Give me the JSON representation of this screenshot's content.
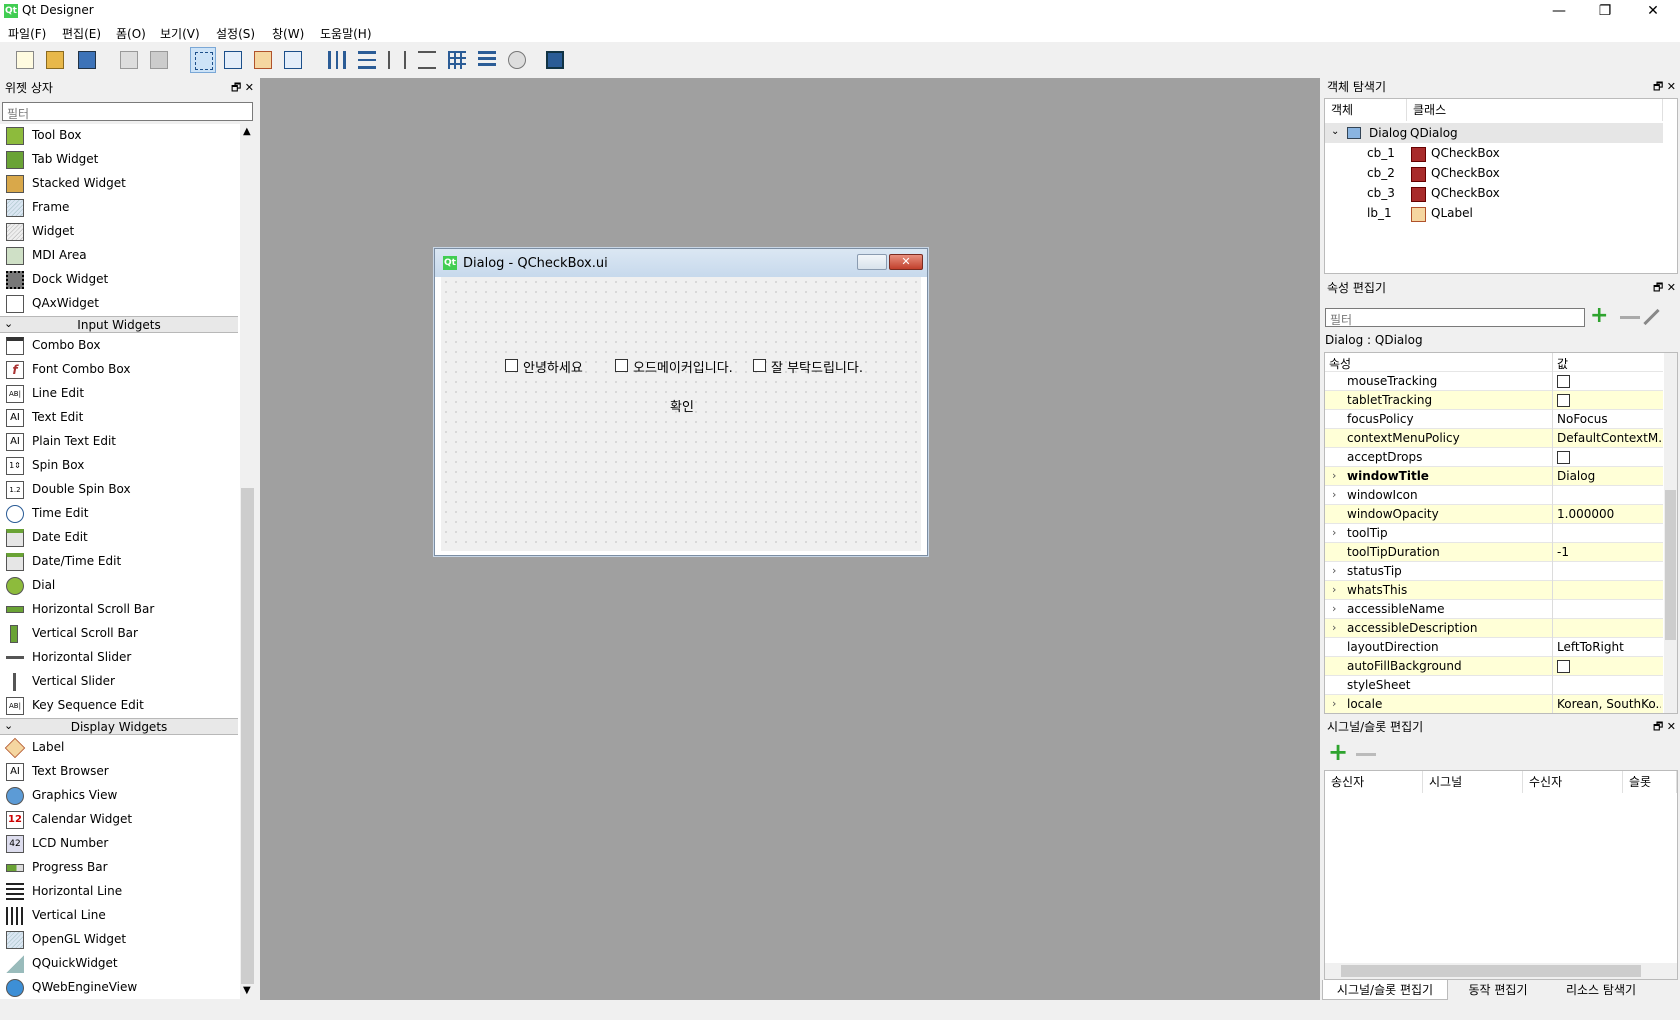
{
  "app": {
    "title": "Qt Designer",
    "logo": "Qt"
  },
  "window_controls": {
    "minimize": "—",
    "maximize": "❐",
    "close": "✕"
  },
  "menu": [
    "파일(F)",
    "편집(E)",
    "폼(O)",
    "보기(V)",
    "설정(S)",
    "창(W)",
    "도움말(H)"
  ],
  "toolbar": {
    "icons": [
      "new-file-icon",
      "open-folder-icon",
      "save-icon",
      "send-to-back-icon",
      "bring-to-front-icon",
      "edit-widgets-icon",
      "edit-signals-slots-icon",
      "edit-buddies-icon",
      "edit-tab-order-icon",
      "layout-horizontal-icon",
      "layout-vertical-icon",
      "layout-h-splitter-icon",
      "layout-v-splitter-icon",
      "layout-grid-icon",
      "layout-form-icon",
      "break-layout-icon",
      "adjust-size-icon"
    ]
  },
  "widget_box": {
    "title": "위젯 상자",
    "filter_placeholder": "필터",
    "items_top": [
      "Tool Box",
      "Tab Widget",
      "Stacked Widget",
      "Frame",
      "Widget",
      "MDI Area",
      "Dock Widget",
      "QAxWidget"
    ],
    "category_input": "Input Widgets",
    "items_input": [
      "Combo Box",
      "Font Combo Box",
      "Line Edit",
      "Text Edit",
      "Plain Text Edit",
      "Spin Box",
      "Double Spin Box",
      "Time Edit",
      "Date Edit",
      "Date/Time Edit",
      "Dial",
      "Horizontal Scroll Bar",
      "Vertical Scroll Bar",
      "Horizontal Slider",
      "Vertical Slider",
      "Key Sequence Edit"
    ],
    "category_display": "Display Widgets",
    "items_display": [
      "Label",
      "Text Browser",
      "Graphics View",
      "Calendar Widget",
      "LCD Number",
      "Progress Bar",
      "Horizontal Line",
      "Vertical Line",
      "OpenGL Widget",
      "QQuickWidget",
      "QWebEngineView"
    ]
  },
  "form": {
    "title": "Dialog - QCheckBox.ui",
    "checkboxes": [
      "안녕하세요",
      "오드메이커입니다.",
      "잘 부탁드립니다."
    ],
    "label": "확인"
  },
  "object_inspector": {
    "title": "객체 탐색기",
    "col_object": "객체",
    "col_class": "클래스",
    "rows": [
      {
        "name": "Dialog",
        "class": "QDialog"
      },
      {
        "name": "cb_1",
        "class": "QCheckBox"
      },
      {
        "name": "cb_2",
        "class": "QCheckBox"
      },
      {
        "name": "cb_3",
        "class": "QCheckBox"
      },
      {
        "name": "lb_1",
        "class": "QLabel"
      }
    ]
  },
  "property_editor": {
    "title": "속성 편집기",
    "filter_placeholder": "필터",
    "object_label": "Dialog : QDialog",
    "col_property": "속성",
    "col_value": "값",
    "rows": [
      {
        "name": "mouseTracking",
        "value": "",
        "check": true
      },
      {
        "name": "tabletTracking",
        "value": "",
        "check": true
      },
      {
        "name": "focusPolicy",
        "value": "NoFocus"
      },
      {
        "name": "contextMenuPolicy",
        "value": "DefaultContextM..."
      },
      {
        "name": "acceptDrops",
        "value": "",
        "check": true
      },
      {
        "name": "windowTitle",
        "value": "Dialog",
        "expand": true,
        "bold": true
      },
      {
        "name": "windowIcon",
        "value": "",
        "expand": true
      },
      {
        "name": "windowOpacity",
        "value": "1.000000"
      },
      {
        "name": "toolTip",
        "value": "",
        "expand": true
      },
      {
        "name": "toolTipDuration",
        "value": "-1"
      },
      {
        "name": "statusTip",
        "value": "",
        "expand": true
      },
      {
        "name": "whatsThis",
        "value": "",
        "expand": true
      },
      {
        "name": "accessibleName",
        "value": "",
        "expand": true
      },
      {
        "name": "accessibleDescription",
        "value": "",
        "expand": true
      },
      {
        "name": "layoutDirection",
        "value": "LeftToRight"
      },
      {
        "name": "autoFillBackground",
        "value": "",
        "check": true
      },
      {
        "name": "styleSheet",
        "value": ""
      },
      {
        "name": "locale",
        "value": "Korean, SouthKo...",
        "expand": true
      }
    ]
  },
  "signal_slot_editor": {
    "title": "시그널/슬롯 편집기",
    "columns": [
      "송신자",
      "시그널",
      "수신자",
      "슬롯"
    ]
  },
  "bottom_tabs": [
    "시그널/슬롯 편집기",
    "동작 편집기",
    "리소스 탐색기"
  ],
  "colors": {
    "accent_green": "#41cd52",
    "central_gray": "#a0a0a0",
    "prop_yellow": "#ffffd7"
  }
}
